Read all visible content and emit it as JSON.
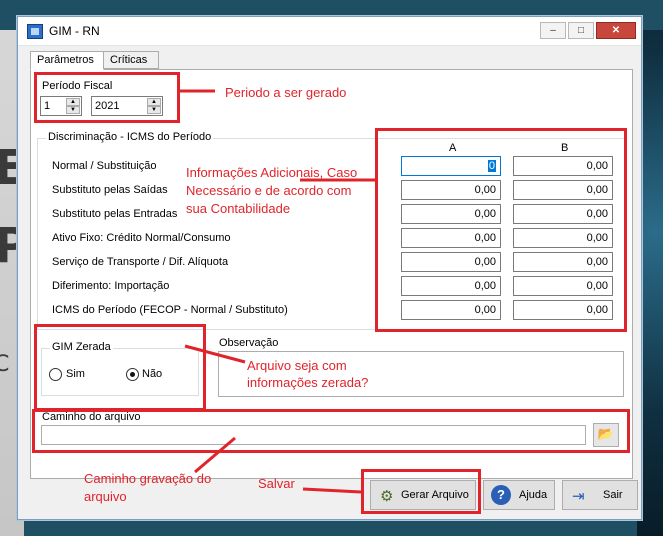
{
  "background": {
    "left_letters": [
      "E",
      "P",
      "C"
    ]
  },
  "window": {
    "title": "GIM - RN",
    "minimize": "–",
    "maximize": "□",
    "close": "✕"
  },
  "tabs": [
    {
      "label": "Parâmetros"
    },
    {
      "label": "Críticas"
    }
  ],
  "periodo": {
    "title": "Período Fiscal",
    "month": "1",
    "year": "2021"
  },
  "discriminacao": {
    "title": "Discriminação - ICMS do Período",
    "col_a": "A",
    "col_b": "B",
    "rows": [
      {
        "label": "Normal / Substituição",
        "a": "0",
        "b": "0,00"
      },
      {
        "label": "Substituto pelas Saídas",
        "a": "0,00",
        "b": "0,00"
      },
      {
        "label": "Substituto pelas Entradas",
        "a": "0,00",
        "b": "0,00"
      },
      {
        "label": "Ativo Fixo: Crédito Normal/Consumo",
        "a": "0,00",
        "b": "0,00"
      },
      {
        "label": "Serviço de Transporte / Dif. Alíquota",
        "a": "0,00",
        "b": "0,00"
      },
      {
        "label": "Diferimento: Importação",
        "a": "0,00",
        "b": "0,00"
      },
      {
        "label": "ICMS do Período (FECOP - Normal / Substituto)",
        "a": "0,00",
        "b": "0,00"
      }
    ]
  },
  "gim_zerada": {
    "title": "GIM Zerada",
    "sim": "Sim",
    "nao": "Não",
    "selected": "Não"
  },
  "observacao": {
    "title": "Observação",
    "value": ""
  },
  "caminho": {
    "title": "Caminho do arquivo",
    "value": ""
  },
  "buttons": {
    "gerar": "Gerar Arquivo",
    "ajuda": "Ajuda",
    "sair": "Sair"
  },
  "annotations": {
    "periodo": "Periodo a ser gerado",
    "info_line1": "Informações Adicionais, Caso",
    "info_line2": "Necessário e de acordo com",
    "info_line3": "sua Contabilidade",
    "zerada_line1": "Arquivo seja com",
    "zerada_line2": "informações zerada?",
    "caminho_line1": "Caminho gravação do",
    "caminho_line2": "arquivo",
    "salvar": "Salvar"
  },
  "colors": {
    "annotation": "#e0242b",
    "accent": "#0078d7",
    "close": "#c9463d"
  },
  "icons": {
    "app": "app-icon",
    "spin": "spin-arrows-icon",
    "folder": "folder-icon",
    "gear": "gear-icon",
    "help": "help-icon",
    "exit": "exit-icon"
  }
}
